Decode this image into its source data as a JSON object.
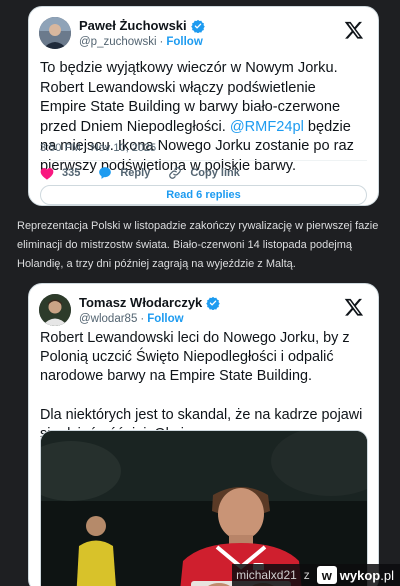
{
  "tweet1": {
    "display_name": "Paweł Żuchowski",
    "handle": "@p_zuchowski",
    "separator": "·",
    "follow_label": "Follow",
    "text_before": "To będzie wyjątkowy wieczór w Nowym Jorku. Robert Lewandowski włączy podświetlenie Empire State Building w barwy biało-czerwone przed Dniem Niepodległości. ",
    "mention": "@RMF24pl",
    "text_after": " będzie na miejscu. Ikona Nowego Jorku zostanie po raz pierwszy podświetlona w polskie barwy.",
    "timestamp": "3:50 PM · Nov 10, 2025",
    "likes": "335",
    "reply_label": "Reply",
    "copy_link_label": "Copy link",
    "read_replies_label": "Read 6 replies"
  },
  "between_text": "Reprezentacja Polski w listopadzie zakończy rywalizację w pierwszej fazie eliminacji do mistrzostw świata. Biało-czerwoni 14 listopada podejmą Holandię, a trzy dni później zagrają na wyjeździe z Maltą.",
  "tweet2": {
    "display_name": "Tomasz Włodarczyk",
    "handle": "@wlodar85",
    "separator": "·",
    "follow_label": "Follow",
    "paragraph1": "Robert Lewandowski leci do Nowego Jorku, by z Polonią uczcić Święto Niepodległości i odpalić narodowe barwy na Empire State Building.",
    "paragraph2": "Dla niektórych jest to skandal, że na kadrze pojawi się dzień później. Okej."
  },
  "footer": {
    "username": "michalxd21",
    "z_label": "z",
    "logo_letter": "w",
    "site_name": "wykop",
    "site_tld": ".pl"
  },
  "icons": {
    "verified": "verified-badge-icon",
    "x_logo": "x-logo-icon",
    "heart": "heart-icon",
    "reply": "reply-bubble-icon",
    "link": "link-icon"
  },
  "colors": {
    "accent": "#1d9bf0",
    "like": "#f91880",
    "page_bg": "#1e1f22",
    "card_bg": "#ffffff",
    "jersey_red": "#cf1f2e"
  }
}
